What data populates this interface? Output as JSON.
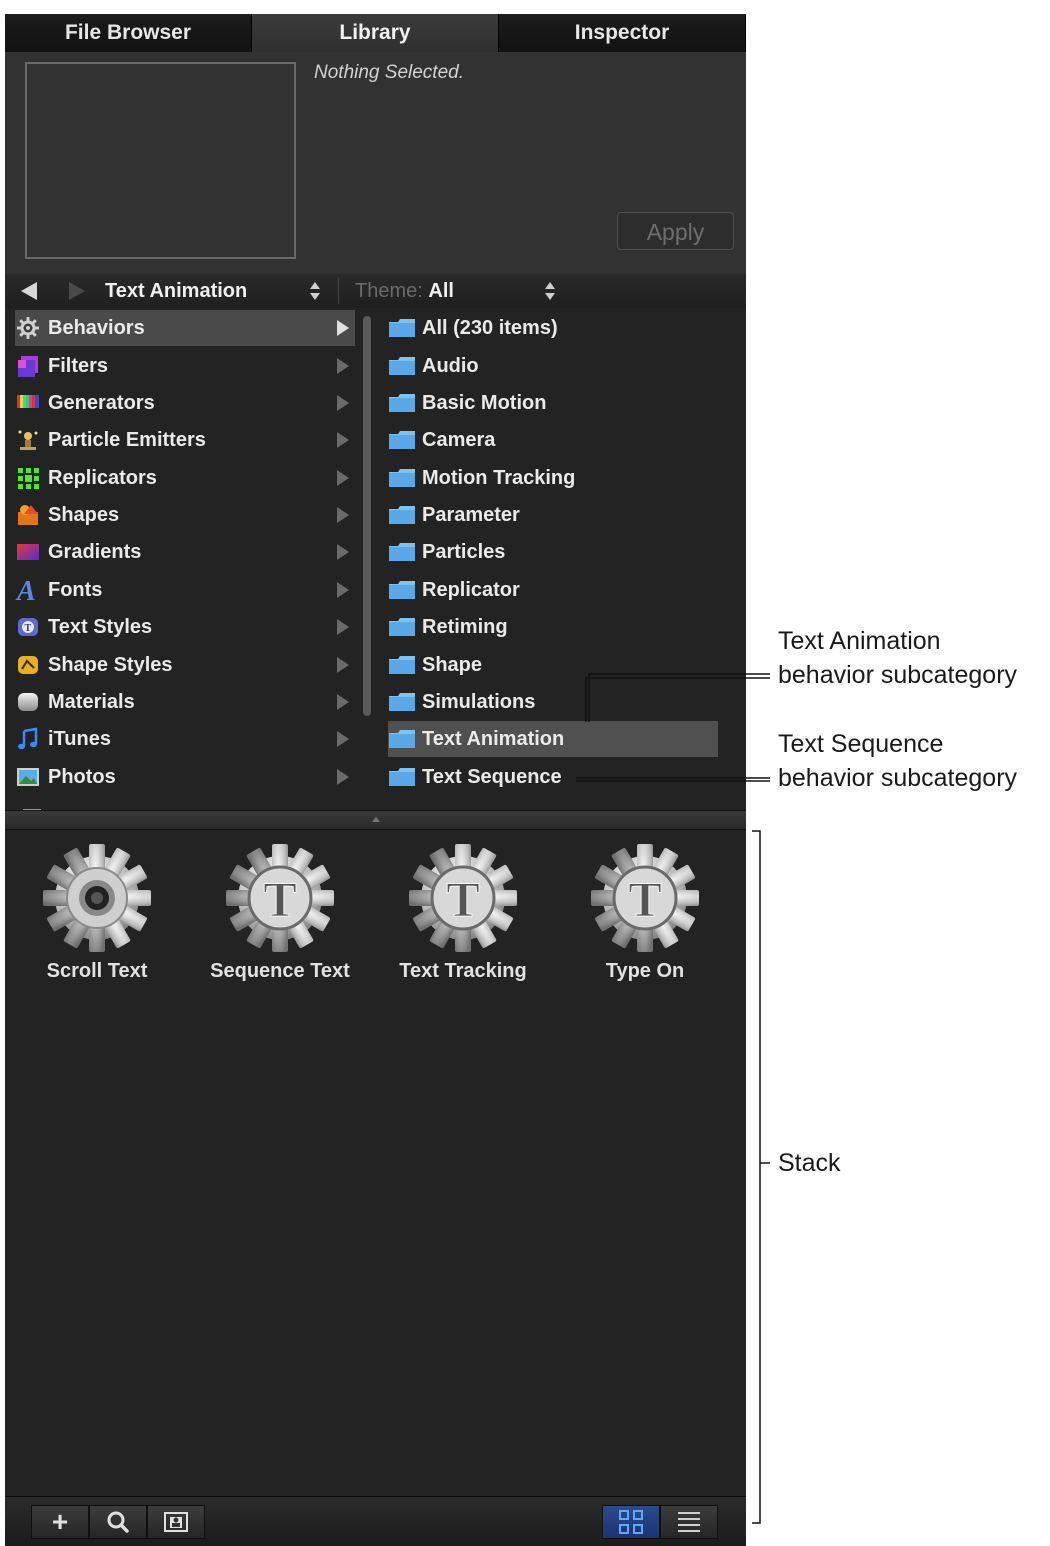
{
  "tabs": [
    "File Browser",
    "Library",
    "Inspector"
  ],
  "preview": {
    "status": "Nothing Selected.",
    "apply_label": "Apply"
  },
  "nav": {
    "category": "Text Animation",
    "theme_label": "Theme:",
    "theme_value": "All"
  },
  "left_items": [
    {
      "label": "Behaviors",
      "icon": "gear-icon",
      "selected": true
    },
    {
      "label": "Filters",
      "icon": "filters-icon"
    },
    {
      "label": "Generators",
      "icon": "generators-icon"
    },
    {
      "label": "Particle Emitters",
      "icon": "particle-emitters-icon"
    },
    {
      "label": "Replicators",
      "icon": "replicators-icon"
    },
    {
      "label": "Shapes",
      "icon": "shapes-icon"
    },
    {
      "label": "Gradients",
      "icon": "gradients-icon"
    },
    {
      "label": "Fonts",
      "icon": "fonts-icon"
    },
    {
      "label": "Text Styles",
      "icon": "text-styles-icon"
    },
    {
      "label": "Shape Styles",
      "icon": "shape-styles-icon"
    },
    {
      "label": "Materials",
      "icon": "materials-icon"
    },
    {
      "label": "iTunes",
      "icon": "music-note-icon"
    },
    {
      "label": "Photos",
      "icon": "photos-icon"
    }
  ],
  "right_items": [
    {
      "label": "All (230 items)"
    },
    {
      "label": "Audio"
    },
    {
      "label": "Basic Motion"
    },
    {
      "label": "Camera"
    },
    {
      "label": "Motion Tracking"
    },
    {
      "label": "Parameter"
    },
    {
      "label": "Particles"
    },
    {
      "label": "Replicator"
    },
    {
      "label": "Retiming"
    },
    {
      "label": "Shape"
    },
    {
      "label": "Simulations"
    },
    {
      "label": "Text Animation",
      "selected": true
    },
    {
      "label": "Text Sequence"
    }
  ],
  "stack_items": [
    {
      "label": "Scroll Text",
      "icon": "scroll-gear-icon"
    },
    {
      "label": "Sequence Text",
      "icon": "text-gear-icon"
    },
    {
      "label": "Text Tracking",
      "icon": "text-gear-icon"
    },
    {
      "label": "Type On",
      "icon": "text-gear-icon"
    }
  ],
  "toolbar": {
    "add": "+",
    "search_icon": "search-icon",
    "preview_icon": "preview-icon",
    "grid_icon": "grid-view-icon",
    "list_icon": "list-view-icon"
  },
  "callouts": {
    "text_animation": [
      "Text Animation",
      "behavior subcategory"
    ],
    "text_sequence": [
      "Text Sequence",
      "behavior subcategory"
    ],
    "stack": "Stack"
  },
  "colors": {
    "panel": "#232323",
    "selected_row": "#4a4a4a",
    "folder": "#5aa9e6",
    "toolbar_blue": "#2c4a8c"
  }
}
